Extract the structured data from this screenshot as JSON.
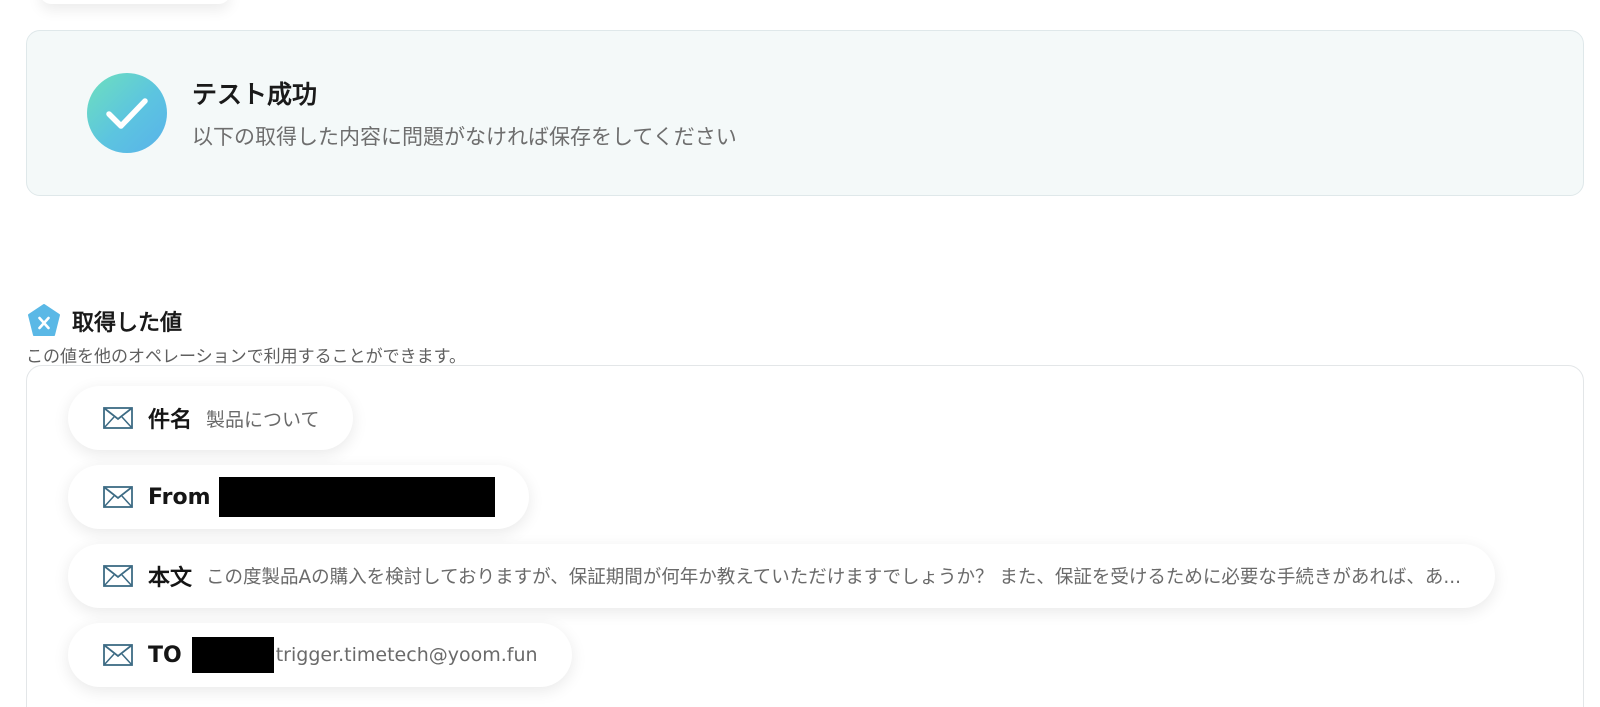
{
  "test_result": {
    "status_icon": "check-icon",
    "title": "テスト成功",
    "message": "以下の取得した内容に問題がなければ保存をしてください"
  },
  "values_section": {
    "icon": "variable-x-icon",
    "title": "取得した値",
    "description": "この値を他のオペレーションで利用することができます。"
  },
  "values": [
    {
      "icon": "mail-icon",
      "label": "件名",
      "value": "製品について"
    },
    {
      "icon": "mail-icon",
      "label": "From",
      "value": "",
      "redacted": true
    },
    {
      "icon": "mail-icon",
      "label": "本文",
      "value": "この度製品Aの購入を検討しておりますが、保証期間が何年か教えていただけますでしょうか？ また、保証を受けるために必要な手続きがあれば、あ..."
    },
    {
      "icon": "mail-icon",
      "label": "TO",
      "value": "trigger.timetech@yoom.fun",
      "redacted_prefix": true
    }
  ],
  "colors": {
    "accent_gradient_start": "#6ee0bd",
    "accent_gradient_end": "#59b2ea",
    "variable_icon": "#5ab8e6",
    "mail_icon_stroke": "#3d6b84"
  }
}
